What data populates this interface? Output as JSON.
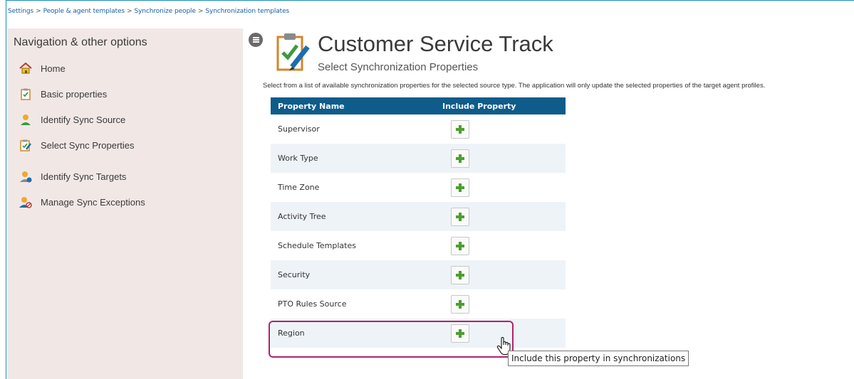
{
  "breadcrumb": {
    "items": [
      "Settings",
      "People & agent templates",
      "Synchronize people",
      "Synchronization templates"
    ],
    "separator": ">"
  },
  "sidebar": {
    "title": "Navigation & other options",
    "items": [
      {
        "label": "Home",
        "icon": "home-icon"
      },
      {
        "label": "Basic properties",
        "icon": "clipboard-check-icon"
      },
      {
        "label": "Identify Sync Source",
        "icon": "person-icon"
      },
      {
        "label": "Select Sync Properties",
        "icon": "clipboard-edit-icon"
      },
      {
        "label": "Identify Sync Targets",
        "icon": "person-target-icon"
      },
      {
        "label": "Manage Sync Exceptions",
        "icon": "person-block-icon"
      }
    ]
  },
  "header": {
    "title": "Customer Service Track",
    "subtitle": "Select Synchronization Properties",
    "description": "Select from a list of available synchronization properties for the selected source type. The application will only update the selected properties of the target agent profiles."
  },
  "table": {
    "columns": [
      "Property Name",
      "Include Property"
    ],
    "rows": [
      {
        "name": "Supervisor"
      },
      {
        "name": "Work Type"
      },
      {
        "name": "Time Zone"
      },
      {
        "name": "Activity Tree"
      },
      {
        "name": "Schedule Templates"
      },
      {
        "name": "Security"
      },
      {
        "name": "PTO Rules Source"
      },
      {
        "name": "Region"
      }
    ]
  },
  "tooltip": "Include this property in synchronizations",
  "colors": {
    "header": "#0f5c8a",
    "highlight": "#b3206e",
    "plus": "#4aa02c",
    "sidebar": "#f1e8e6"
  }
}
